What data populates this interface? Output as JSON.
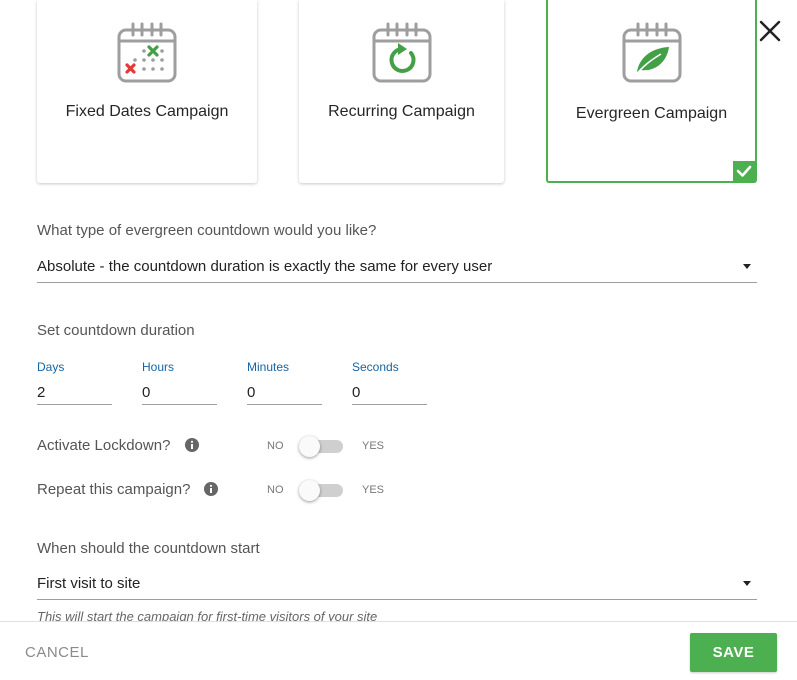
{
  "campaign_types": [
    {
      "label": "Fixed Dates Campaign",
      "icon": "calendar-fixed-dates-icon"
    },
    {
      "label": "Recurring Campaign",
      "icon": "calendar-recurring-icon"
    },
    {
      "label": "Evergreen Campaign",
      "icon": "calendar-evergreen-leaf-icon",
      "selected": true
    }
  ],
  "countdown_type": {
    "question": "What type of evergreen countdown would you like?",
    "selected": "Absolute - the countdown duration is exactly the same for every user"
  },
  "duration": {
    "title": "Set countdown duration",
    "fields": [
      {
        "label": "Days",
        "value": "2"
      },
      {
        "label": "Hours",
        "value": "0"
      },
      {
        "label": "Minutes",
        "value": "0"
      },
      {
        "label": "Seconds",
        "value": "0"
      }
    ]
  },
  "toggles": {
    "lockdown": {
      "label": "Activate Lockdown?",
      "off_label": "NO",
      "on_label": "YES",
      "on": false
    },
    "repeat": {
      "label": "Repeat this campaign?",
      "off_label": "NO",
      "on_label": "YES",
      "on": false
    }
  },
  "start": {
    "question": "When should the countdown start",
    "selected": "First visit to site",
    "hint": "This will start the campaign for first-time visitors of your site"
  },
  "footer": {
    "cancel_label": "CANCEL",
    "save_label": "SAVE"
  },
  "colors": {
    "accent": "#4caf50",
    "label_blue": "#1565a6"
  }
}
